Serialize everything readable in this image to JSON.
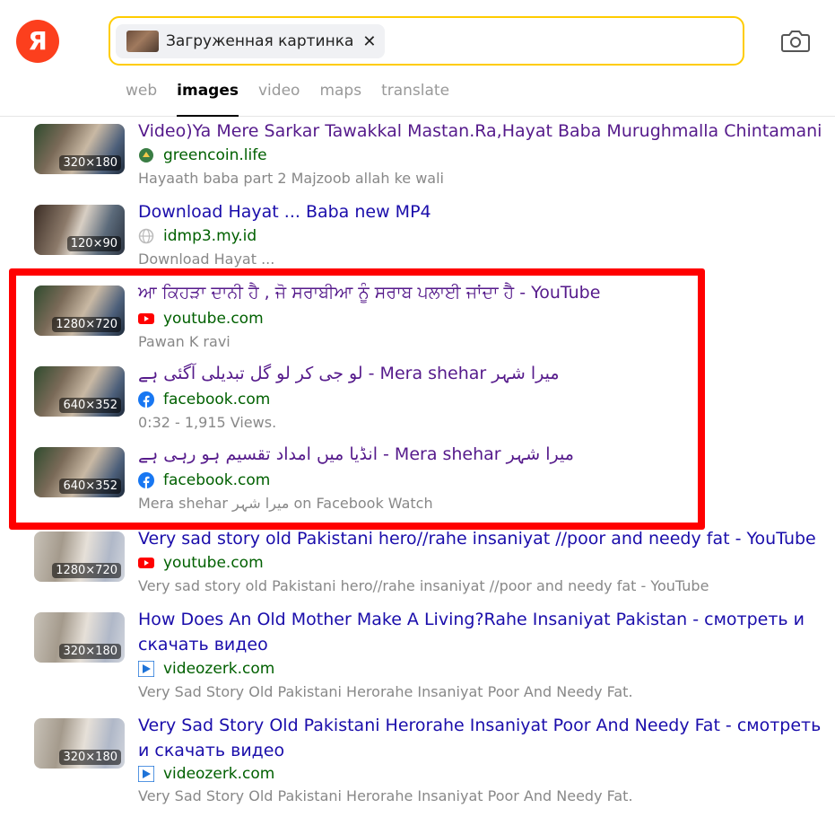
{
  "header": {
    "logo_letter": "Я",
    "search_chip": {
      "label": "Загруженная картинка",
      "close": "✕"
    },
    "tabs": [
      {
        "label": "web"
      },
      {
        "label": "images"
      },
      {
        "label": "video"
      },
      {
        "label": "maps"
      },
      {
        "label": "translate"
      }
    ],
    "active_tab": "images"
  },
  "results": [
    {
      "title": "Video)Ya Mere Sarkar Tawakkal Mastan.Ra,Hayat Baba Murughmalla Chintamani",
      "domain": "greencoin.life",
      "favicon": "greencoin-icon",
      "snippet": "Hayaath baba part 2 Majzoob allah ke wali",
      "thumb_size": "320×180"
    },
    {
      "title": "Download Hayat ... Baba new MP4",
      "domain": "idmp3.my.id",
      "favicon": "globe-icon",
      "snippet": "Download Hayat ...",
      "thumb_size": "120×90"
    },
    {
      "title": "ਆ ਕਿਹੜਾ ਦਾਨੀ ਹੈ , ਜੋ ਸਰਾਬੀਆ ਨੂੰ ਸਰਾਬ ਪਲਾਈ ਜਾਂਦਾ ਹੈ - YouTube",
      "domain": "youtube.com",
      "favicon": "youtube-icon",
      "snippet": "Pawan K ravi",
      "thumb_size": "1280×720"
    },
    {
      "title": "لو جی کر لو گل تبدیلی آگئی ہے - Mera shehar میرا شہر",
      "domain": "facebook.com",
      "favicon": "facebook-icon",
      "snippet": "0:32 - 1,915 Views.",
      "thumb_size": "640×352"
    },
    {
      "title": "انڈیا میں امداد تقسیم ہو رہی ہے - Mera shehar میرا شہر",
      "domain": "facebook.com",
      "favicon": "facebook-icon",
      "snippet": "Mera shehar میرا شہر on Facebook Watch",
      "thumb_size": "640×352"
    },
    {
      "title": "Very sad story old Pakistani hero//rahe insaniyat //poor and needy fat - YouTube",
      "domain": "youtube.com",
      "favicon": "youtube-icon",
      "snippet": "Very sad story old Pakistani hero//rahe insaniyat //poor and needy fat - YouTube",
      "thumb_size": "1280×720"
    },
    {
      "title": "How Does An Old Mother Make A Living?Rahe Insaniyat Pakistan - смотреть и скачать видео",
      "domain": "videozerk.com",
      "favicon": "videozerk-icon",
      "snippet": "Very Sad Story Old Pakistani Herorahe Insaniyat Poor And Needy Fat.",
      "thumb_size": "320×180"
    },
    {
      "title": "Very Sad Story Old Pakistani Herorahe Insaniyat Poor And Needy Fat - смотреть и скачать видео",
      "domain": "videozerk.com",
      "favicon": "videozerk-icon",
      "snippet": "Very Sad Story Old Pakistani Herorahe Insaniyat Poor And Needy Fat.",
      "thumb_size": "320×180"
    }
  ],
  "colors": {
    "brand": "#fc3f1d",
    "search_border": "#ffcc00",
    "link": "#1a0dab",
    "visited_link": "#551a8b",
    "domain": "#006000",
    "highlight": "#ff0000"
  }
}
